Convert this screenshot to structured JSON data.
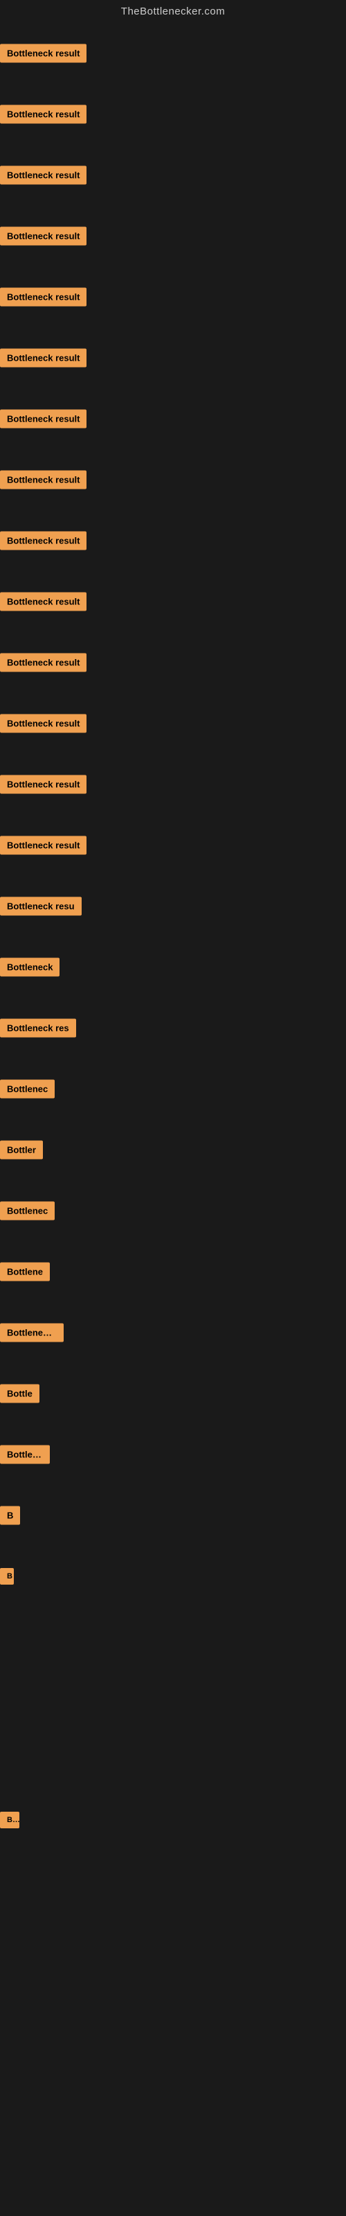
{
  "header": {
    "title": "TheBottlenecker.com"
  },
  "rows": [
    {
      "id": 1,
      "label": "Bottleneck result"
    },
    {
      "id": 2,
      "label": "Bottleneck result"
    },
    {
      "id": 3,
      "label": "Bottleneck result"
    },
    {
      "id": 4,
      "label": "Bottleneck result"
    },
    {
      "id": 5,
      "label": "Bottleneck result"
    },
    {
      "id": 6,
      "label": "Bottleneck result"
    },
    {
      "id": 7,
      "label": "Bottleneck result"
    },
    {
      "id": 8,
      "label": "Bottleneck result"
    },
    {
      "id": 9,
      "label": "Bottleneck result"
    },
    {
      "id": 10,
      "label": "Bottleneck result"
    },
    {
      "id": 11,
      "label": "Bottleneck result"
    },
    {
      "id": 12,
      "label": "Bottleneck result"
    },
    {
      "id": 13,
      "label": "Bottleneck result"
    },
    {
      "id": 14,
      "label": "Bottleneck result"
    },
    {
      "id": 15,
      "label": "Bottleneck resu"
    },
    {
      "id": 16,
      "label": "Bottleneck"
    },
    {
      "id": 17,
      "label": "Bottleneck res"
    },
    {
      "id": 18,
      "label": "Bottlenec"
    },
    {
      "id": 19,
      "label": "Bottler"
    },
    {
      "id": 20,
      "label": "Bottlenec"
    },
    {
      "id": 21,
      "label": "Bottlene"
    },
    {
      "id": 22,
      "label": "Bottleneck r"
    },
    {
      "id": 23,
      "label": "Bottle"
    },
    {
      "id": 24,
      "label": "Bottlenec"
    },
    {
      "id": 25,
      "label": "B"
    },
    {
      "id": 26,
      "label": "B"
    },
    {
      "id": 27,
      "label": ""
    },
    {
      "id": 28,
      "label": ""
    },
    {
      "id": 29,
      "label": ""
    },
    {
      "id": 30,
      "label": "Bo"
    },
    {
      "id": 31,
      "label": ""
    },
    {
      "id": 32,
      "label": ""
    },
    {
      "id": 33,
      "label": ""
    },
    {
      "id": 34,
      "label": ""
    },
    {
      "id": 35,
      "label": ""
    },
    {
      "id": 36,
      "label": ""
    }
  ]
}
